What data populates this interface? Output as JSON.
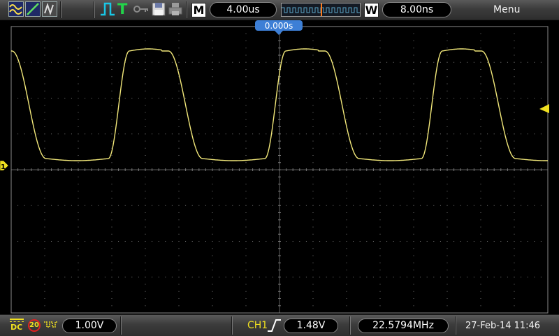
{
  "top_bar": {
    "run_status": "T",
    "horizontal_label": "M",
    "timebase": "4.00us",
    "window_label": "W",
    "window_timebase": "8.00ns",
    "menu": "Menu"
  },
  "screen": {
    "trigger_time_position": "0.000s",
    "channel_marker": "1",
    "colors": {
      "trace": "#f2e87a",
      "marker": "#f0e020",
      "grid": "#7a7a7a",
      "pos_label": "#3d7fd6"
    }
  },
  "bottom_bar": {
    "coupling": "DC",
    "bandwidth_limit": "20",
    "ch1_scale": "1.00V",
    "trigger_source": "CH1",
    "trigger_level": "1.48V",
    "frequency": "22.5794MHz",
    "datetime": "27-Feb-14 11:46"
  }
}
